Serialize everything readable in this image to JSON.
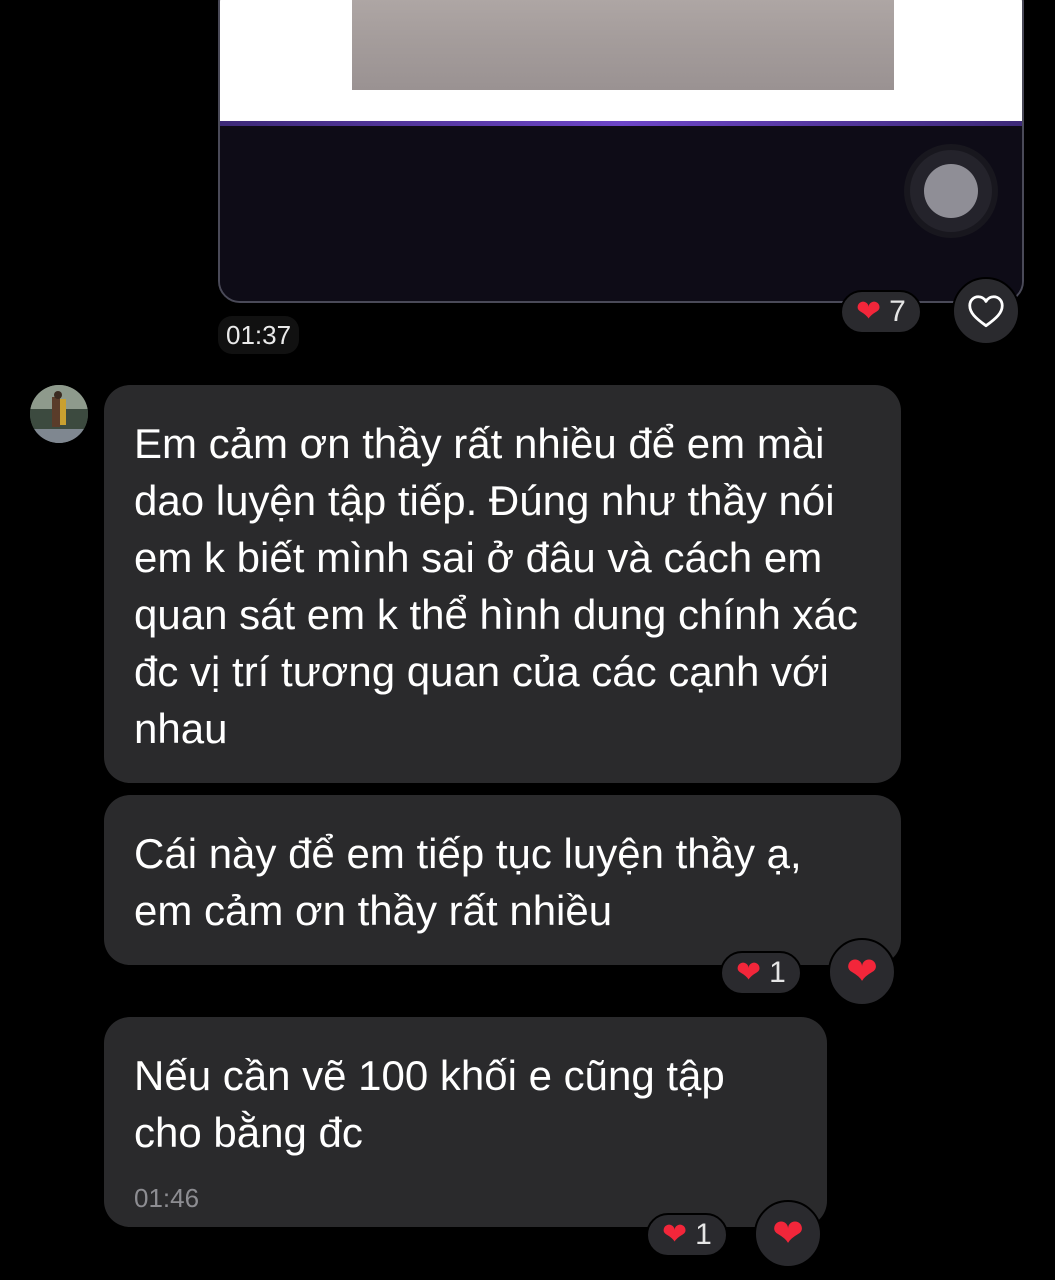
{
  "colors": {
    "background": "#000000",
    "bubble": "#2a2a2c",
    "heart": "#f2263a",
    "accent_bar": "#6d46c8"
  },
  "media": {
    "reaction": {
      "icon": "heart-icon",
      "count": "7"
    },
    "like_button_icon": "heart-outline-icon",
    "time": "01:37"
  },
  "messages": [
    {
      "text": "Em cảm ơn thầy rất nhiều để em mài dao luyện tập tiếp. Đúng như thầy nói em k biết mình sai ở đâu và cách em quan sát em k thể hình dung chính xác đc vị trí tương quan của các cạnh với nhau"
    },
    {
      "text": "Cái này để em tiếp tục luyện thầy ạ, em cảm ơn thầy rất nhiều",
      "reaction": {
        "icon": "heart-icon",
        "count": "1"
      }
    },
    {
      "text": "Nếu cần vẽ 100 khối e cũng tập cho bằng đc",
      "time": "01:46",
      "reaction": {
        "icon": "heart-icon",
        "count": "1"
      }
    }
  ]
}
